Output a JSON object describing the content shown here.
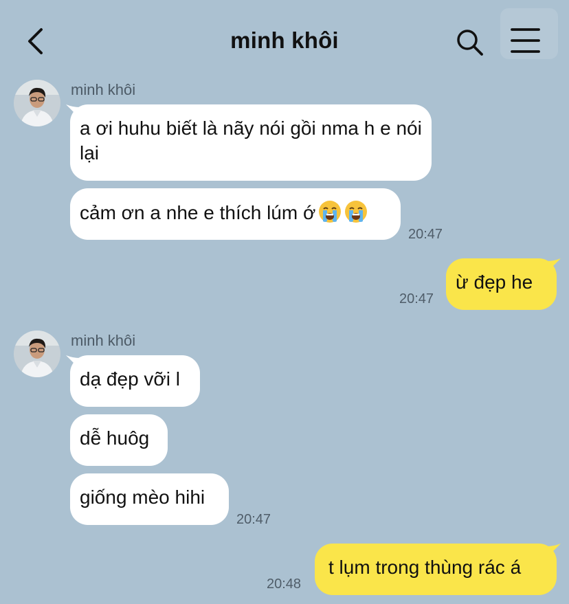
{
  "header": {
    "title": "minh khôi",
    "back_icon": "chevron-left-icon",
    "search_icon": "search-icon",
    "menu_icon": "hamburger-menu-icon"
  },
  "colors": {
    "background": "#abc1d1",
    "incoming_bubble": "#ffffff",
    "outgoing_bubble": "#fae54a"
  },
  "groups": [
    {
      "sender": "minh khôi",
      "messages": [
        "a ơi huhu biết là nãy nói gồi nma h e nói lại",
        "cảm ơn a nhe e thích lúm ớ"
      ],
      "emojis": [
        "loudly-crying-face-emoji",
        "loudly-crying-face-emoji"
      ],
      "time": "20:47"
    },
    {
      "sender": "me",
      "messages": [
        "ừ đẹp he"
      ],
      "time": "20:47"
    },
    {
      "sender": "minh khôi",
      "messages": [
        "dạ đẹp vỡi l",
        "dễ huôg",
        "giống mèo hihi"
      ],
      "time": "20:47"
    },
    {
      "sender": "me",
      "messages": [
        "t lụm trong thùng rác á"
      ],
      "time": "20:48"
    }
  ]
}
